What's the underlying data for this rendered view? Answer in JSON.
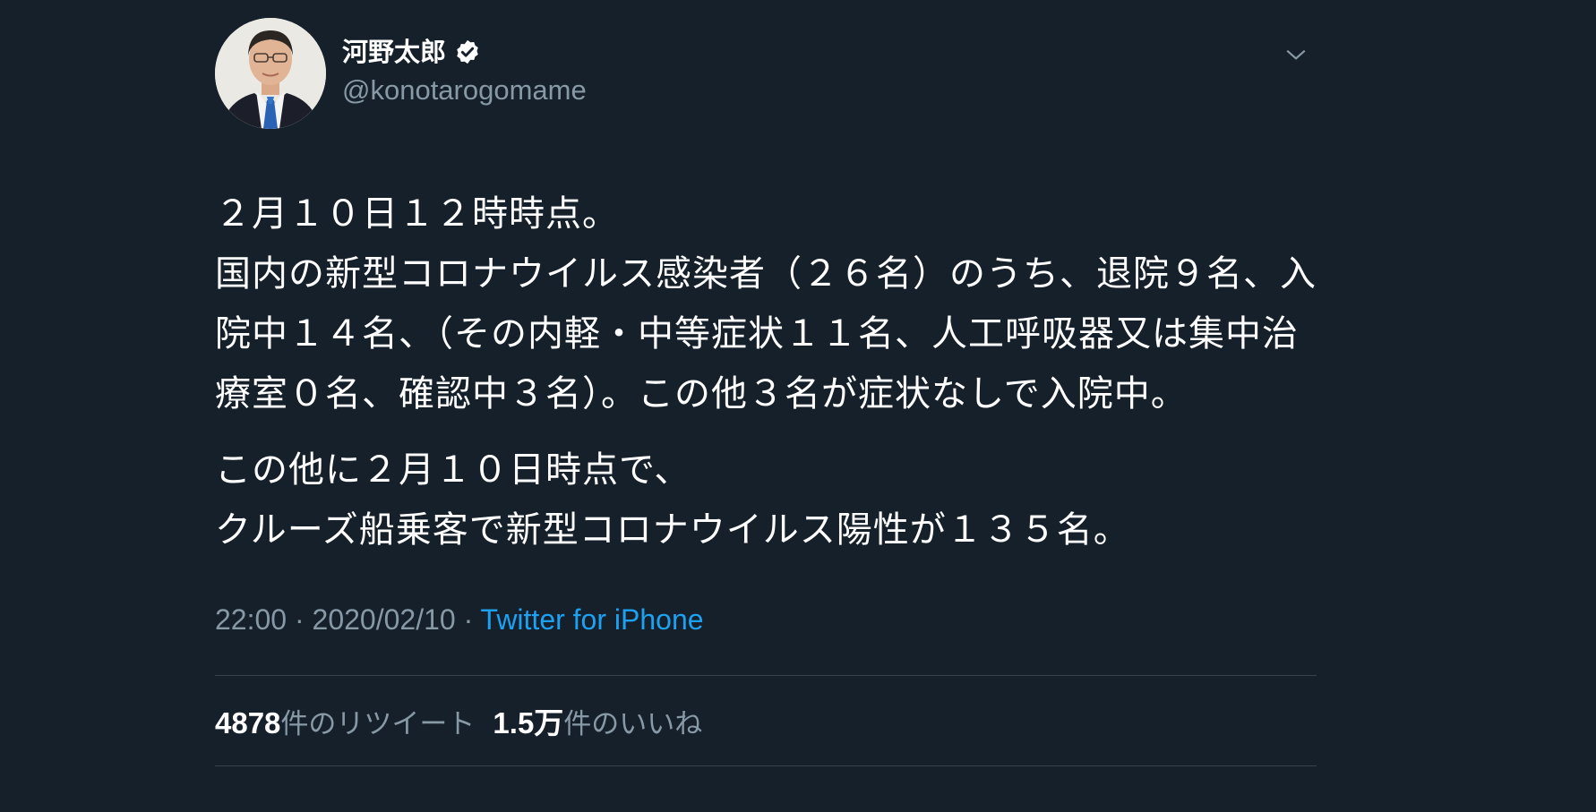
{
  "user": {
    "display_name": "河野太郎",
    "handle": "@konotarogomame",
    "verified": true
  },
  "tweet": {
    "paragraph1": "２月１０日１２時時点。\n国内の新型コロナウイルス感染者（２６名）のうち、退院９名、入院中１４名、（その内軽・中等症状１１名、人工呼吸器又は集中治療室０名、確認中３名）。この他３名が症状なしで入院中。",
    "paragraph2": "この他に２月１０日時点で、\nクルーズ船乗客で新型コロナウイルス陽性が１３５名。"
  },
  "meta": {
    "time": "22:00",
    "separator": " · ",
    "date": "2020/02/10",
    "source": "Twitter for iPhone"
  },
  "stats": {
    "retweets_count": "4878",
    "retweets_label": "件のリツイート",
    "likes_count": "1.5万",
    "likes_label": "件のいいね"
  },
  "icons": {
    "verified": "verified-badge-icon",
    "caret": "chevron-down-icon"
  },
  "colors": {
    "background": "#15202b",
    "secondary_text": "#8899a6",
    "link": "#1da1f2",
    "divider": "#38444d"
  }
}
